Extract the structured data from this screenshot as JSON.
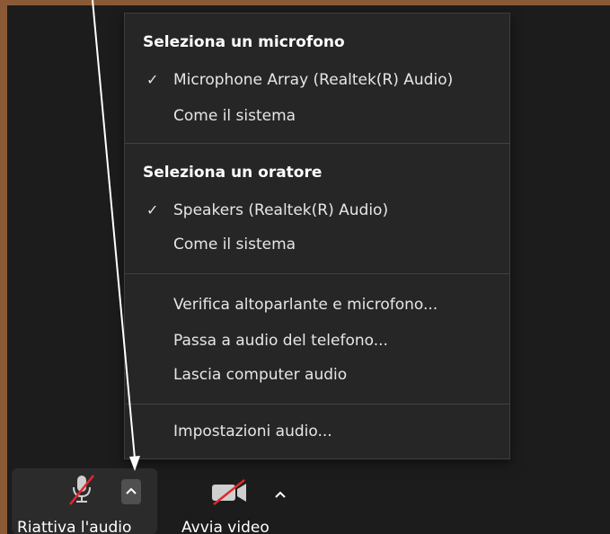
{
  "menu": {
    "microphone": {
      "title": "Seleziona un microfono",
      "items": [
        {
          "label": "Microphone Array (Realtek(R) Audio)",
          "checked": true
        },
        {
          "label": "Come il sistema",
          "checked": false
        }
      ]
    },
    "speaker": {
      "title": "Seleziona un oratore",
      "items": [
        {
          "label": "Speakers (Realtek(R) Audio)",
          "checked": true
        },
        {
          "label": "Come il sistema",
          "checked": false
        }
      ]
    },
    "actions": [
      {
        "label": "Verifica altoparlante e microfono..."
      },
      {
        "label": "Passa a audio del telefono..."
      },
      {
        "label": "Lascia computer audio"
      }
    ],
    "settings": {
      "label": "Impostazioni audio..."
    }
  },
  "toolbar": {
    "unmute_label": "Riattiva l'audio",
    "start_video_label": "Avvia video"
  },
  "icons": {
    "check": "✓",
    "mic": "microphone-muted-icon",
    "video": "video-off-icon",
    "caret": "chevron-up-icon"
  },
  "colors": {
    "background_frame": "#8a5a36",
    "window": "#1c1c1c",
    "menu": "#262626",
    "muted_red": "#e0282e",
    "text": "#e6e6e6"
  }
}
